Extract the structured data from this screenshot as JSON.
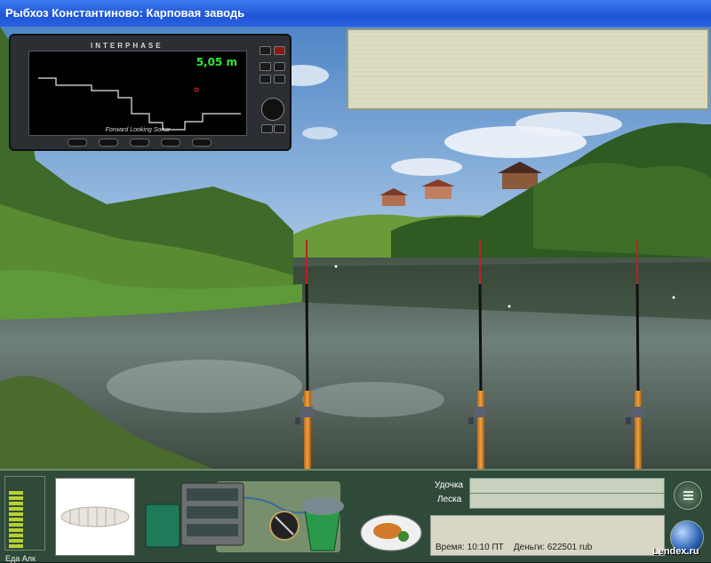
{
  "window": {
    "title": "Рыбхоз Константиново: Карповая заводь"
  },
  "sonar": {
    "brand": "INTERPHASE",
    "depth": "5,05 m",
    "caption": "Forward Looking Sonar"
  },
  "hud": {
    "meter_labels": {
      "food": "Еда",
      "alcohol": "Алк"
    },
    "tackle": {
      "rod_label": "Удочка",
      "line_label": "Леска"
    },
    "status": {
      "time_label": "Время:",
      "time_value": "10:10 ПТ",
      "money_label": "Деньги:",
      "money_value": "622501 rub"
    }
  },
  "watermark": "Lendex.ru"
}
